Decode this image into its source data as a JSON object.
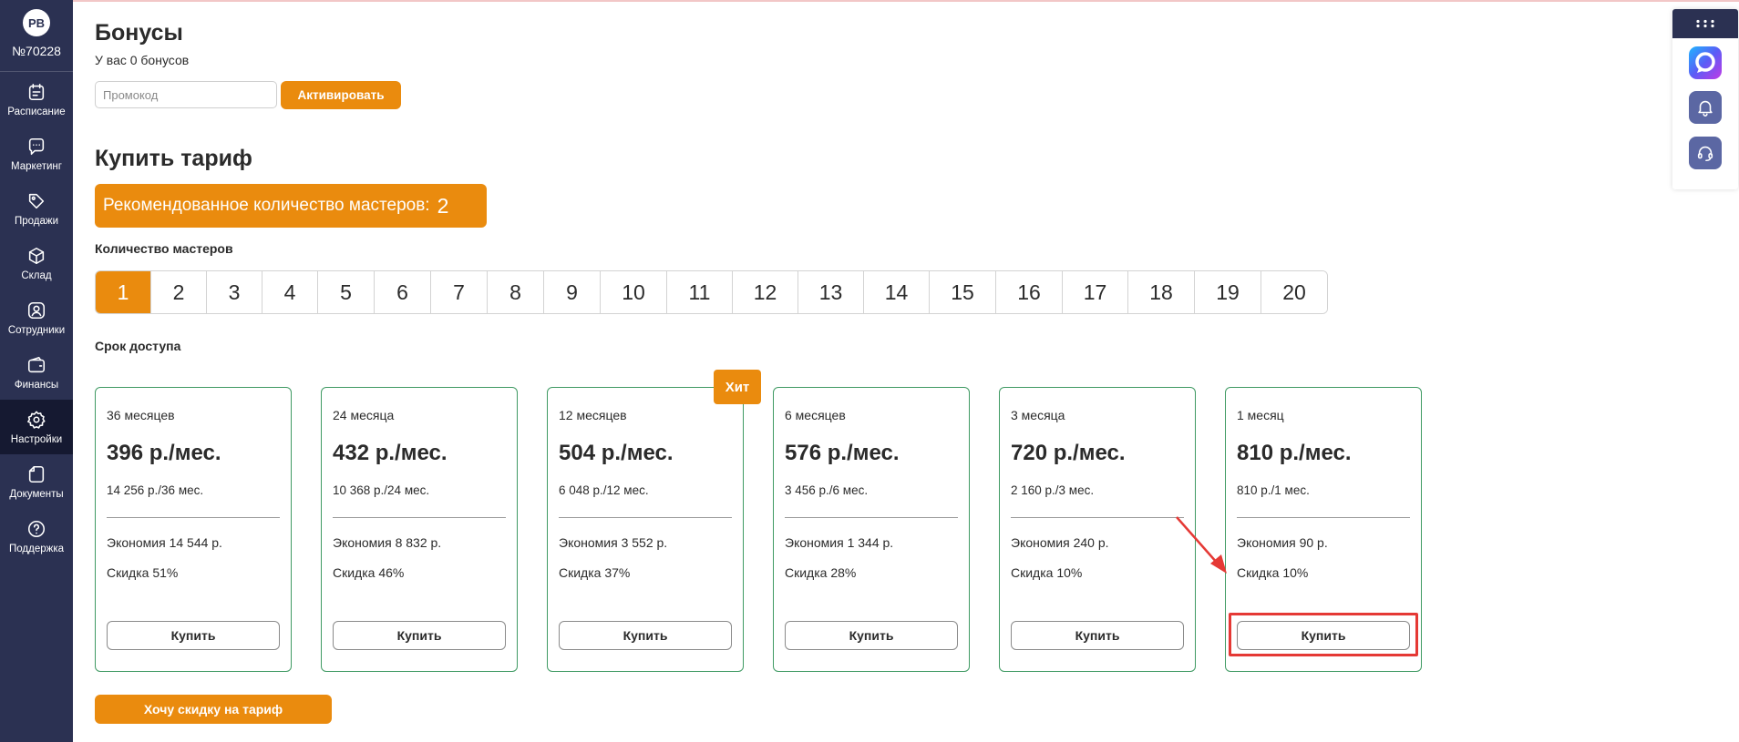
{
  "sidebar": {
    "avatar_initials": "РВ",
    "user_id": "№70228",
    "items": [
      {
        "label": "Расписание",
        "icon": "calendar-icon",
        "active": false
      },
      {
        "label": "Маркетинг",
        "icon": "chat-bubble-icon",
        "active": false
      },
      {
        "label": "Продажи",
        "icon": "tag-icon",
        "active": false
      },
      {
        "label": "Склад",
        "icon": "box-icon",
        "active": false
      },
      {
        "label": "Сотрудники",
        "icon": "user-icon",
        "active": false
      },
      {
        "label": "Финансы",
        "icon": "wallet-icon",
        "active": false
      },
      {
        "label": "Настройки",
        "icon": "gear-icon",
        "active": true
      },
      {
        "label": "Документы",
        "icon": "document-icon",
        "active": false
      },
      {
        "label": "Поддержка",
        "icon": "help-icon",
        "active": false
      }
    ]
  },
  "bonus": {
    "title": "Бонусы",
    "subtitle": "У вас 0 бонусов",
    "promo_placeholder": "Промокод",
    "activate_label": "Активировать"
  },
  "tariff": {
    "title": "Купить тариф",
    "recommend_label": "Рекомендованное количество мастеров:",
    "recommend_value": "2",
    "masters_label": "Количество мастеров",
    "masters": [
      "1",
      "2",
      "3",
      "4",
      "5",
      "6",
      "7",
      "8",
      "9",
      "10",
      "11",
      "12",
      "13",
      "14",
      "15",
      "16",
      "17",
      "18",
      "19",
      "20"
    ],
    "selected_master": "1",
    "term_label": "Срок доступа",
    "hit_label": "Хит",
    "cards": [
      {
        "period": "36 месяцев",
        "price": "396 р./мес.",
        "total": "14 256 р./36 мес.",
        "economy": "Экономия 14 544 р.",
        "discount": "Скидка 51%",
        "buy": "Купить"
      },
      {
        "period": "24 месяца",
        "price": "432 р./мес.",
        "total": "10 368 р./24 мес.",
        "economy": "Экономия 8 832 р.",
        "discount": "Скидка 46%",
        "buy": "Купить"
      },
      {
        "period": "12 месяцев",
        "price": "504 р./мес.",
        "total": "6 048 р./12 мес.",
        "economy": "Экономия 3 552 р.",
        "discount": "Скидка 37%",
        "buy": "Купить"
      },
      {
        "period": "6 месяцев",
        "price": "576 р./мес.",
        "total": "3 456 р./6 мес.",
        "economy": "Экономия 1 344 р.",
        "discount": "Скидка 28%",
        "buy": "Купить"
      },
      {
        "period": "3 месяца",
        "price": "720 р./мес.",
        "total": "2 160 р./3 мес.",
        "economy": "Экономия 240 р.",
        "discount": "Скидка 10%",
        "buy": "Купить"
      },
      {
        "period": "1 месяц",
        "price": "810 р./мес.",
        "total": "810 р./1 мес.",
        "economy": "Экономия 90 р.",
        "discount": "Скидка 10%",
        "buy": "Купить"
      }
    ],
    "discount_button": "Хочу скидку на тариф"
  },
  "colors": {
    "sidebar": "#2b3152",
    "accent": "#ea8b0e",
    "card_border": "#3f9a63",
    "highlight": "#e53935"
  }
}
